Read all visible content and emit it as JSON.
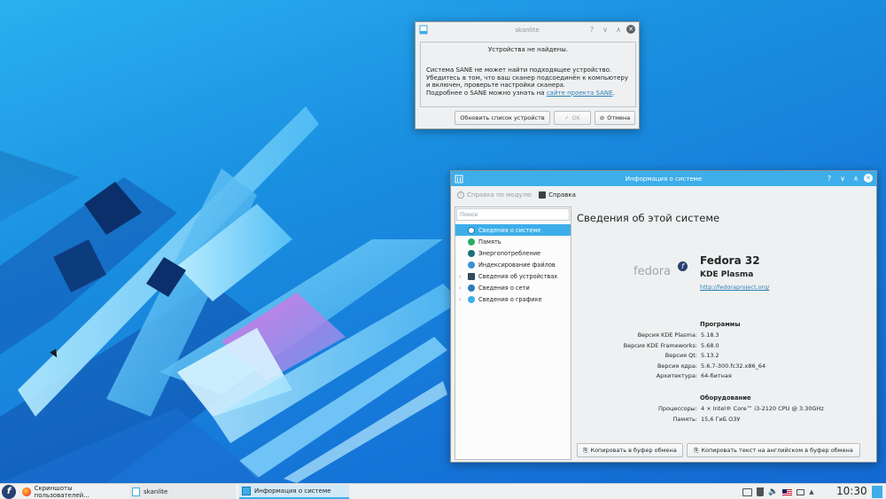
{
  "scanner_dialog": {
    "title": "skanlite",
    "heading": "Устройства не найдены.",
    "body_line1": "Система SANE не может найти подходящее устройство.",
    "body_line2": "Убедитесь в том, что ваш сканер подсоединён к компьютеру",
    "body_line3": "и включен, проверьте настройки сканера.",
    "body_line4_prefix": "Подробнее о SANE можно узнать на ",
    "body_link": "сайте проекта SANE",
    "body_line4_suffix": ".",
    "refresh_button": "Обновить список устройств",
    "ok_button": "OK",
    "cancel_button": "Отмена",
    "title_buttons": [
      "?",
      "∨",
      "∧"
    ]
  },
  "info_window": {
    "title": "Информация о системе",
    "toolbar_module_help": "Справка по модулю",
    "toolbar_help": "Справка",
    "search_placeholder": "Поиск",
    "tree_items": [
      {
        "label": "Сведения о системе",
        "color": "#3daee9"
      },
      {
        "label": "Память",
        "color": "#27ae60"
      },
      {
        "label": "Энергопотребление",
        "color": "#1d6f7a"
      },
      {
        "label": "Индексирование файлов",
        "color": "#3b8ed8"
      },
      {
        "label": "Сведения об устройствах",
        "color": "#34495e"
      },
      {
        "label": "Сведения о сети",
        "color": "#2980b9"
      },
      {
        "label": "Сведения о графике",
        "color": "#3daee9"
      }
    ],
    "page_heading": "Сведения об этой системе",
    "logo_text": "fedora",
    "distro_name": "Fedora 32",
    "desktop_name": "KDE Plasma",
    "distro_url": "http://fedoraproject.org/",
    "software_heading": "Программы",
    "software": [
      {
        "label": "Версия KDE Plasma:",
        "value": "5.18.3"
      },
      {
        "label": "Версия KDE Frameworks:",
        "value": "5.68.0"
      },
      {
        "label": "Версия Qt:",
        "value": "5.13.2"
      },
      {
        "label": "Версия ядра:",
        "value": "5.6.7-300.fc32.x86_64"
      },
      {
        "label": "Архитектура:",
        "value": "64-битная"
      }
    ],
    "hardware_heading": "Оборудование",
    "hardware": [
      {
        "label": "Процессоры:",
        "value": "4 × Intel® Core™ i3-2120 CPU @ 3.30GHz"
      },
      {
        "label": "Память:",
        "value": "15,6 ГиБ ОЗУ"
      }
    ],
    "copy_button": "Копировать в буфер обмена",
    "copy_en_button": "Копировать текст на английском в буфер обмена",
    "title_buttons": [
      "?",
      "∨",
      "∧"
    ]
  },
  "taskbar": {
    "tasks": [
      {
        "label": "Скриншоты пользователей..."
      },
      {
        "label": "skanlite"
      },
      {
        "label": "Информация о системе"
      }
    ],
    "clock": "10:30"
  }
}
